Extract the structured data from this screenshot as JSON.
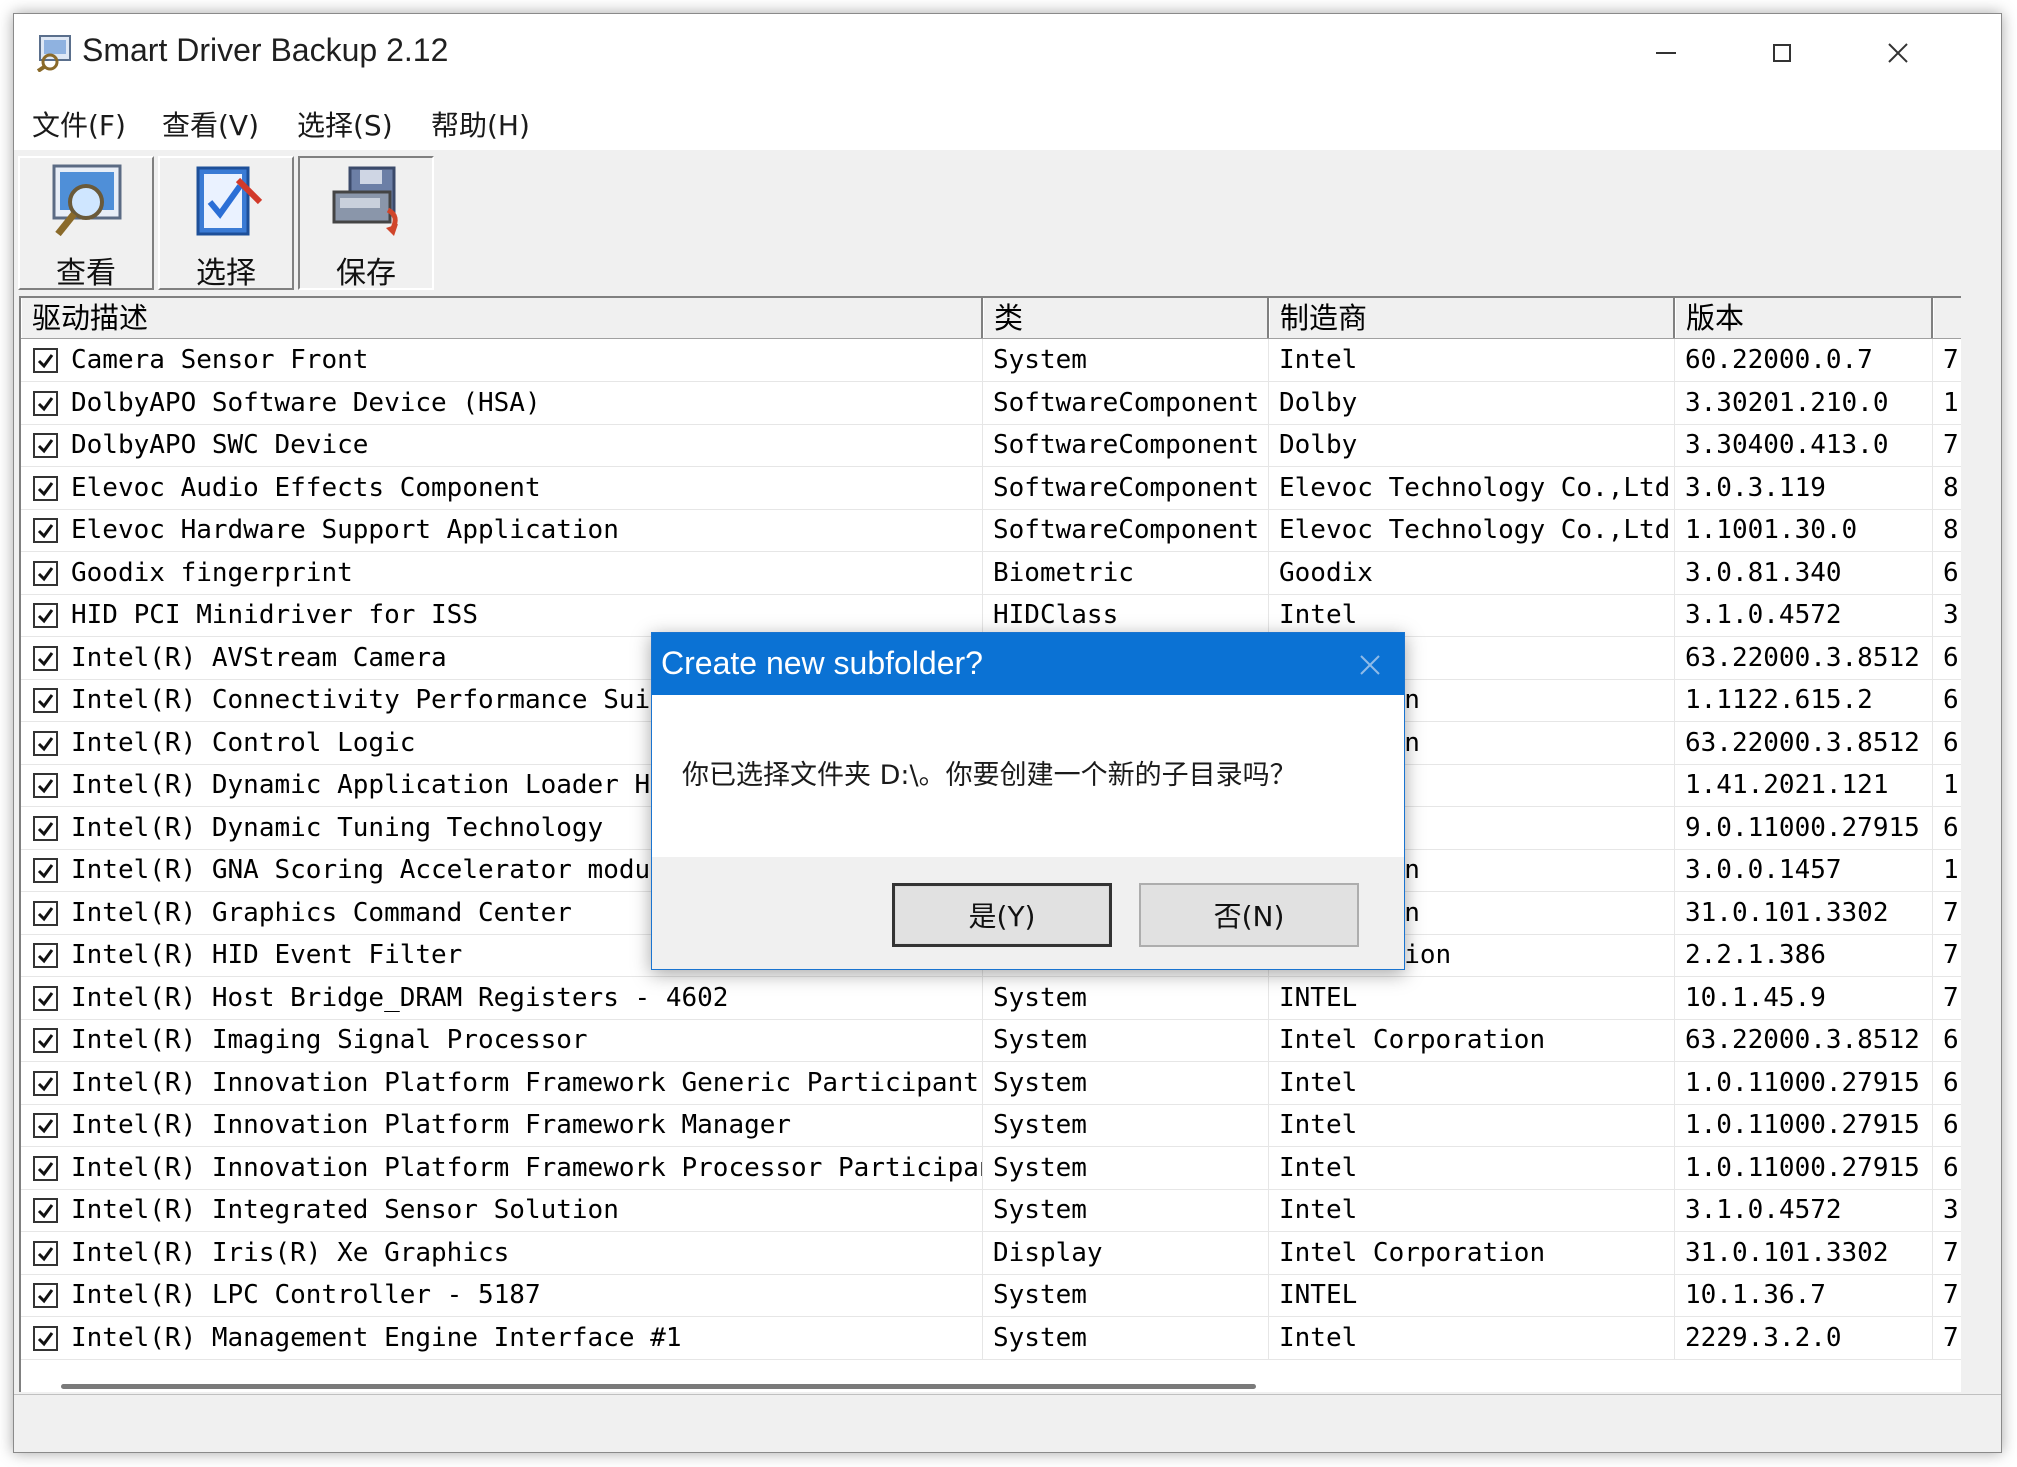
{
  "window": {
    "title": "Smart Driver Backup 2.12"
  },
  "menu": [
    "文件(F)",
    "查看(V)",
    "选择(S)",
    "帮助(H)"
  ],
  "toolbar": [
    {
      "label": "查看",
      "icon": "magnifier-view-icon",
      "pressed": false
    },
    {
      "label": "选择",
      "icon": "checklist-select-icon",
      "pressed": false
    },
    {
      "label": "保存",
      "icon": "floppy-save-icon",
      "pressed": true
    }
  ],
  "columns": [
    "驱动描述",
    "类",
    "制造商",
    "版本",
    ""
  ],
  "rows": [
    {
      "checked": true,
      "desc": "Camera Sensor Front",
      "class": "System",
      "maker": "Intel",
      "version": "60.22000.0.7",
      "extra": "7"
    },
    {
      "checked": true,
      "desc": "DolbyAPO Software Device (HSA)",
      "class": "SoftwareComponent",
      "maker": "Dolby",
      "version": "3.30201.210.0",
      "extra": "1"
    },
    {
      "checked": true,
      "desc": "DolbyAPO SWC Device",
      "class": "SoftwareComponent",
      "maker": "Dolby",
      "version": "3.30400.413.0",
      "extra": "7"
    },
    {
      "checked": true,
      "desc": "Elevoc Audio Effects Component",
      "class": "SoftwareComponent",
      "maker": "Elevoc Technology Co.,Ltd",
      "version": "3.0.3.119",
      "extra": "8"
    },
    {
      "checked": true,
      "desc": "Elevoc Hardware Support Application",
      "class": "SoftwareComponent",
      "maker": "Elevoc Technology Co.,Ltd",
      "version": "1.1001.30.0",
      "extra": "8"
    },
    {
      "checked": true,
      "desc": "Goodix fingerprint",
      "class": "Biometric",
      "maker": "Goodix",
      "version": "3.0.81.340",
      "extra": "6"
    },
    {
      "checked": true,
      "desc": "HID PCI Minidriver for ISS",
      "class": "HIDClass",
      "maker": "Intel",
      "version": "3.1.0.4572",
      "extra": "3"
    },
    {
      "checked": true,
      "desc": "Intel(R) AVStream Camera",
      "class": "",
      "maker": "",
      "version": "63.22000.3.8512",
      "extra": "6"
    },
    {
      "checked": true,
      "desc": "Intel(R) Connectivity Performance Suite",
      "class": "",
      "maker": "rporation",
      "version": "1.1122.615.2",
      "extra": "6"
    },
    {
      "checked": true,
      "desc": "Intel(R) Control Logic",
      "class": "",
      "maker": "rporation",
      "version": "63.22000.3.8512",
      "extra": "6"
    },
    {
      "checked": true,
      "desc": "Intel(R) Dynamic Application Loader Hos",
      "class": "",
      "maker": "",
      "version": "1.41.2021.121",
      "extra": "1"
    },
    {
      "checked": true,
      "desc": "Intel(R) Dynamic Tuning Technology",
      "class": "",
      "maker": "",
      "version": "9.0.11000.27915",
      "extra": "6"
    },
    {
      "checked": true,
      "desc": "Intel(R) GNA Scoring Accelerator module",
      "class": "",
      "maker": "rporation",
      "version": "3.0.0.1457",
      "extra": "1"
    },
    {
      "checked": true,
      "desc": "Intel(R) Graphics Command Center",
      "class": "",
      "maker": "rporation",
      "version": "31.0.101.3302",
      "extra": "7"
    },
    {
      "checked": true,
      "desc": "Intel(R) HID Event Filter",
      "class": "",
      "maker": "Corporation",
      "version": "2.2.1.386",
      "extra": "7"
    },
    {
      "checked": true,
      "desc": "Intel(R) Host Bridge_DRAM Registers - 4602",
      "class": "System",
      "maker": "INTEL",
      "version": "10.1.45.9",
      "extra": "7"
    },
    {
      "checked": true,
      "desc": "Intel(R) Imaging Signal Processor",
      "class": "System",
      "maker": "Intel Corporation",
      "version": "63.22000.3.8512",
      "extra": "6"
    },
    {
      "checked": true,
      "desc": "Intel(R) Innovation Platform Framework Generic Participant",
      "class": "System",
      "maker": "Intel",
      "version": "1.0.11000.27915",
      "extra": "6"
    },
    {
      "checked": true,
      "desc": "Intel(R) Innovation Platform Framework Manager",
      "class": "System",
      "maker": "Intel",
      "version": "1.0.11000.27915",
      "extra": "6"
    },
    {
      "checked": true,
      "desc": "Intel(R) Innovation Platform Framework Processor Participant",
      "class": "System",
      "maker": "Intel",
      "version": "1.0.11000.27915",
      "extra": "6"
    },
    {
      "checked": true,
      "desc": "Intel(R) Integrated Sensor Solution",
      "class": "System",
      "maker": "Intel",
      "version": "3.1.0.4572",
      "extra": "3"
    },
    {
      "checked": true,
      "desc": "Intel(R) Iris(R) Xe Graphics",
      "class": "Display",
      "maker": "Intel Corporation",
      "version": "31.0.101.3302",
      "extra": "7"
    },
    {
      "checked": true,
      "desc": "Intel(R) LPC Controller - 5187",
      "class": "System",
      "maker": "INTEL",
      "version": "10.1.36.7",
      "extra": "7"
    },
    {
      "checked": true,
      "desc": "Intel(R) Management Engine Interface #1",
      "class": "System",
      "maker": "Intel",
      "version": "2229.3.2.0",
      "extra": "7"
    }
  ],
  "dialog": {
    "title": "Create new subfolder?",
    "message": "你已选择文件夹 D:\\。你要创建一个新的子目录吗？",
    "yes_label": "是(Y)",
    "no_label": "否(N)"
  },
  "colors": {
    "dialog_title_bar": "#0b72d4",
    "window_bg": "#f0f0f0",
    "list_bg": "#ffffff"
  }
}
